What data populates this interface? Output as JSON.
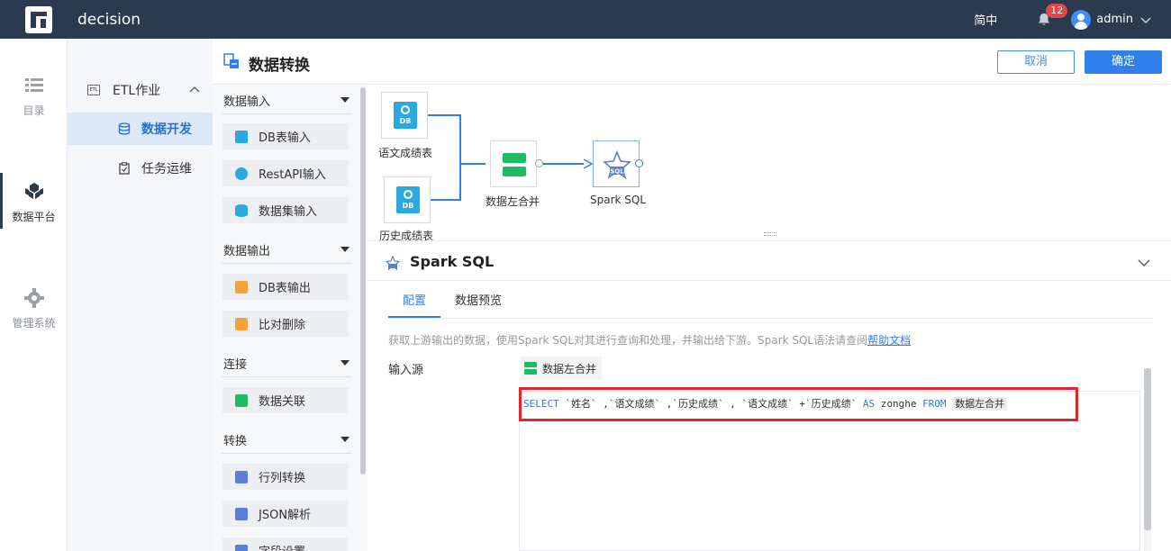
{
  "topbar": {
    "app_name": "decision",
    "language": "简中",
    "notification_count": "12",
    "user": "admin"
  },
  "leftnav": {
    "items": [
      {
        "label": "目录",
        "icon": "list-icon"
      },
      {
        "label": "数据平台",
        "icon": "cube-icon",
        "active": true
      },
      {
        "label": "管理系统",
        "icon": "gear-icon"
      }
    ]
  },
  "subnav": {
    "group": "ETL作业",
    "group_icon_text": "ETL",
    "items": [
      {
        "label": "数据开发",
        "active": true
      },
      {
        "label": "任务运维"
      }
    ]
  },
  "header": {
    "title": "数据转换",
    "cancel_label": "取消",
    "ok_label": "确定"
  },
  "panel": {
    "categories": [
      {
        "label": "数据输入",
        "items": [
          "DB表输入",
          "RestAPI输入",
          "数据集输入"
        ]
      },
      {
        "label": "数据输出",
        "items": [
          "DB表输出",
          "比对删除"
        ]
      },
      {
        "label": "连接",
        "items": [
          "数据关联"
        ]
      },
      {
        "label": "转换",
        "items": [
          "行列转换",
          "JSON解析",
          "字段设置"
        ]
      }
    ]
  },
  "canvas": {
    "nodes": [
      {
        "label": "语文成绩表",
        "icon_text": "DB"
      },
      {
        "label": "历史成绩表",
        "icon_text": "DB"
      },
      {
        "label": "数据左合并"
      },
      {
        "label": "Spark SQL",
        "icon_text": "SQL"
      }
    ]
  },
  "props": {
    "title": "Spark SQL",
    "tabs": [
      "配置",
      "数据预览"
    ],
    "description": "获取上游输出的数据，使用Spark SQL对其进行查询和处理，并输出给下游。Spark SQL语法请查阅",
    "help_link": "帮助文档",
    "input_label": "输入源",
    "input_source": "数据左合并",
    "sql": {
      "kw_select": "SELECT",
      "part1": " `姓名` ,`语文成绩` ,`历史成绩` , `语文成绩` +`历史成绩` ",
      "kw_as": "AS",
      "alias": " zonghe ",
      "kw_from": "FROM",
      "table": "数据左合并"
    }
  },
  "colors": {
    "topbar": "#2c3a4f",
    "primary": "#2f80ed",
    "db_icon": "#29a9e0",
    "merge_icon": "#1dbb63",
    "highlight_box": "#e0262c"
  }
}
